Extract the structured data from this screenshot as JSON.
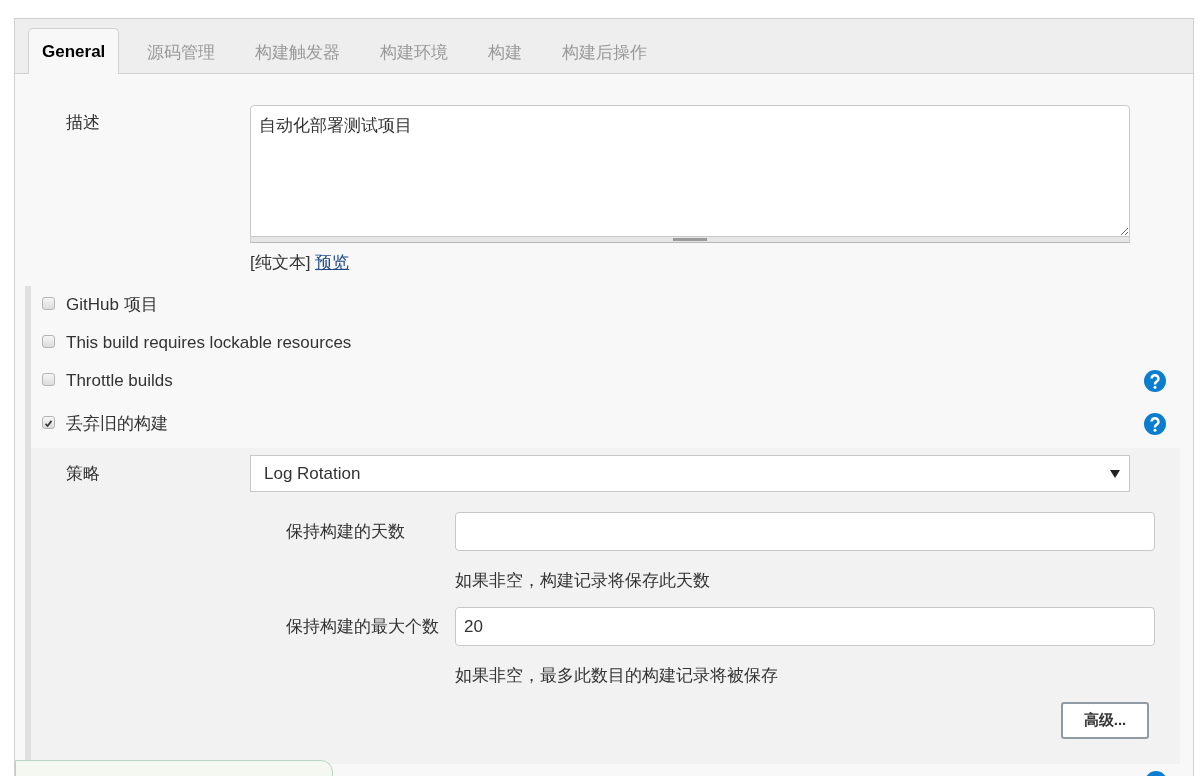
{
  "tabs": [
    {
      "label": "General",
      "selected": true
    },
    {
      "label": "源码管理",
      "selected": false
    },
    {
      "label": "构建触发器",
      "selected": false
    },
    {
      "label": "构建环境",
      "selected": false
    },
    {
      "label": "构建",
      "selected": false
    },
    {
      "label": "构建后操作",
      "selected": false
    }
  ],
  "description": {
    "label": "描述",
    "value": "自动化部署测试项目",
    "format_note": "[纯文本]",
    "preview_link": "预览"
  },
  "options": [
    {
      "label": "GitHub 项目",
      "checked": false,
      "help": false
    },
    {
      "label": "This build requires lockable resources",
      "checked": false,
      "help": false
    },
    {
      "label": "Throttle builds",
      "checked": false,
      "help": true
    },
    {
      "label": "丢弃旧的构建",
      "checked": true,
      "help": true
    }
  ],
  "strategy": {
    "label": "策略",
    "value": "Log Rotation",
    "fields": [
      {
        "label": "保持构建的天数",
        "hint": "如果非空，构建记录将保存此天数"
      },
      {
        "label": "保持构建的最大个数",
        "value": "20",
        "hint": "如果非空，最多此数目的构建记录将被保存"
      }
    ],
    "advanced_button": "高级..."
  }
}
